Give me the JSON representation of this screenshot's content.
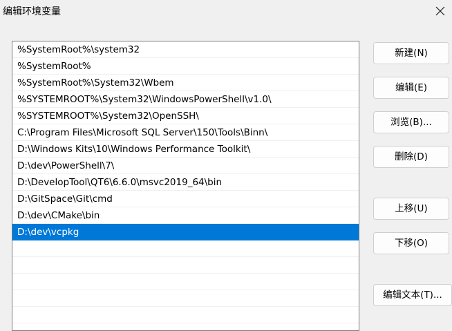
{
  "window": {
    "title": "编辑环境变量",
    "close_icon": "close-icon"
  },
  "path_list": {
    "items": [
      "%SystemRoot%\\system32",
      "%SystemRoot%",
      "%SystemRoot%\\System32\\Wbem",
      "%SYSTEMROOT%\\System32\\WindowsPowerShell\\v1.0\\",
      "%SYSTEMROOT%\\System32\\OpenSSH\\",
      "C:\\Program Files\\Microsoft SQL Server\\150\\Tools\\Binn\\",
      "D:\\Windows Kits\\10\\Windows Performance Toolkit\\",
      "D:\\dev\\PowerShell\\7\\",
      "D:\\DevelopTool\\QT6\\6.6.0\\msvc2019_64\\bin",
      "D:\\GitSpace\\Git\\cmd",
      "D:\\dev\\CMake\\bin",
      "D:\\dev\\vcpkg",
      "",
      "",
      "",
      "",
      ""
    ],
    "selected_index": 11,
    "selection_color": "#0078d7"
  },
  "buttons": {
    "new": "新建(N)",
    "edit": "编辑(E)",
    "browse": "浏览(B)...",
    "delete": "删除(D)",
    "move_up": "上移(U)",
    "move_down": "下移(O)",
    "edit_text": "编辑文本(T)..."
  }
}
